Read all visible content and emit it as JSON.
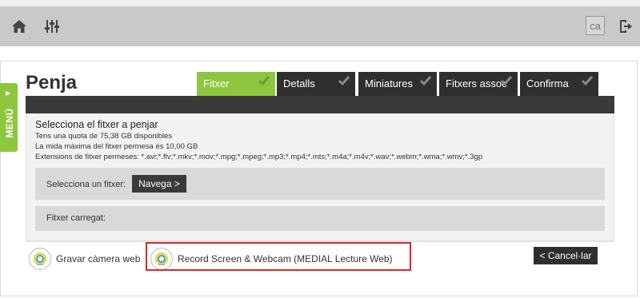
{
  "topbar": {
    "icons": [
      "home-icon",
      "sliders-icon",
      "logout-icon"
    ],
    "language": "ca"
  },
  "menu": {
    "label": "MENÚ"
  },
  "page": {
    "title": "Penja"
  },
  "tabs": [
    {
      "label": "Fitxer",
      "active": true
    },
    {
      "label": "Detalls",
      "active": false
    },
    {
      "label": "Miniatures",
      "active": false
    },
    {
      "label": "Fitxers assoc",
      "active": false
    },
    {
      "label": "Confirma",
      "active": false
    }
  ],
  "upload": {
    "heading": "Selecciona el fitxer a penjar",
    "quota": "Tens una quota de 75,38 GB disponibles",
    "max_size": "La mida màxima del fitxer permesa és 10,00 GB",
    "extensions": "Extensions de fitxer permeses: *.avi;*.flv;*.mkv;*.mov;*.mpg;*.mpeg;*.mp3;*.mp4;*.mts;*.m4a;*.m4v;*.wav;*.webm;*.wma;*.wmv;*.3gp",
    "select_label": "Selecciona un fitxer:",
    "browse_label": "Navega >",
    "loaded_label": "Fitxer carregat:"
  },
  "footer": {
    "record_webcam": "Gravar càmera web",
    "record_screen": "Record Screen & Webcam (MEDIAL Lecture Web)",
    "cancel": "< Cancel·lar"
  },
  "colors": {
    "accent": "#8ec63f",
    "dark": "#2f2f2f",
    "highlight": "#d9272e"
  }
}
